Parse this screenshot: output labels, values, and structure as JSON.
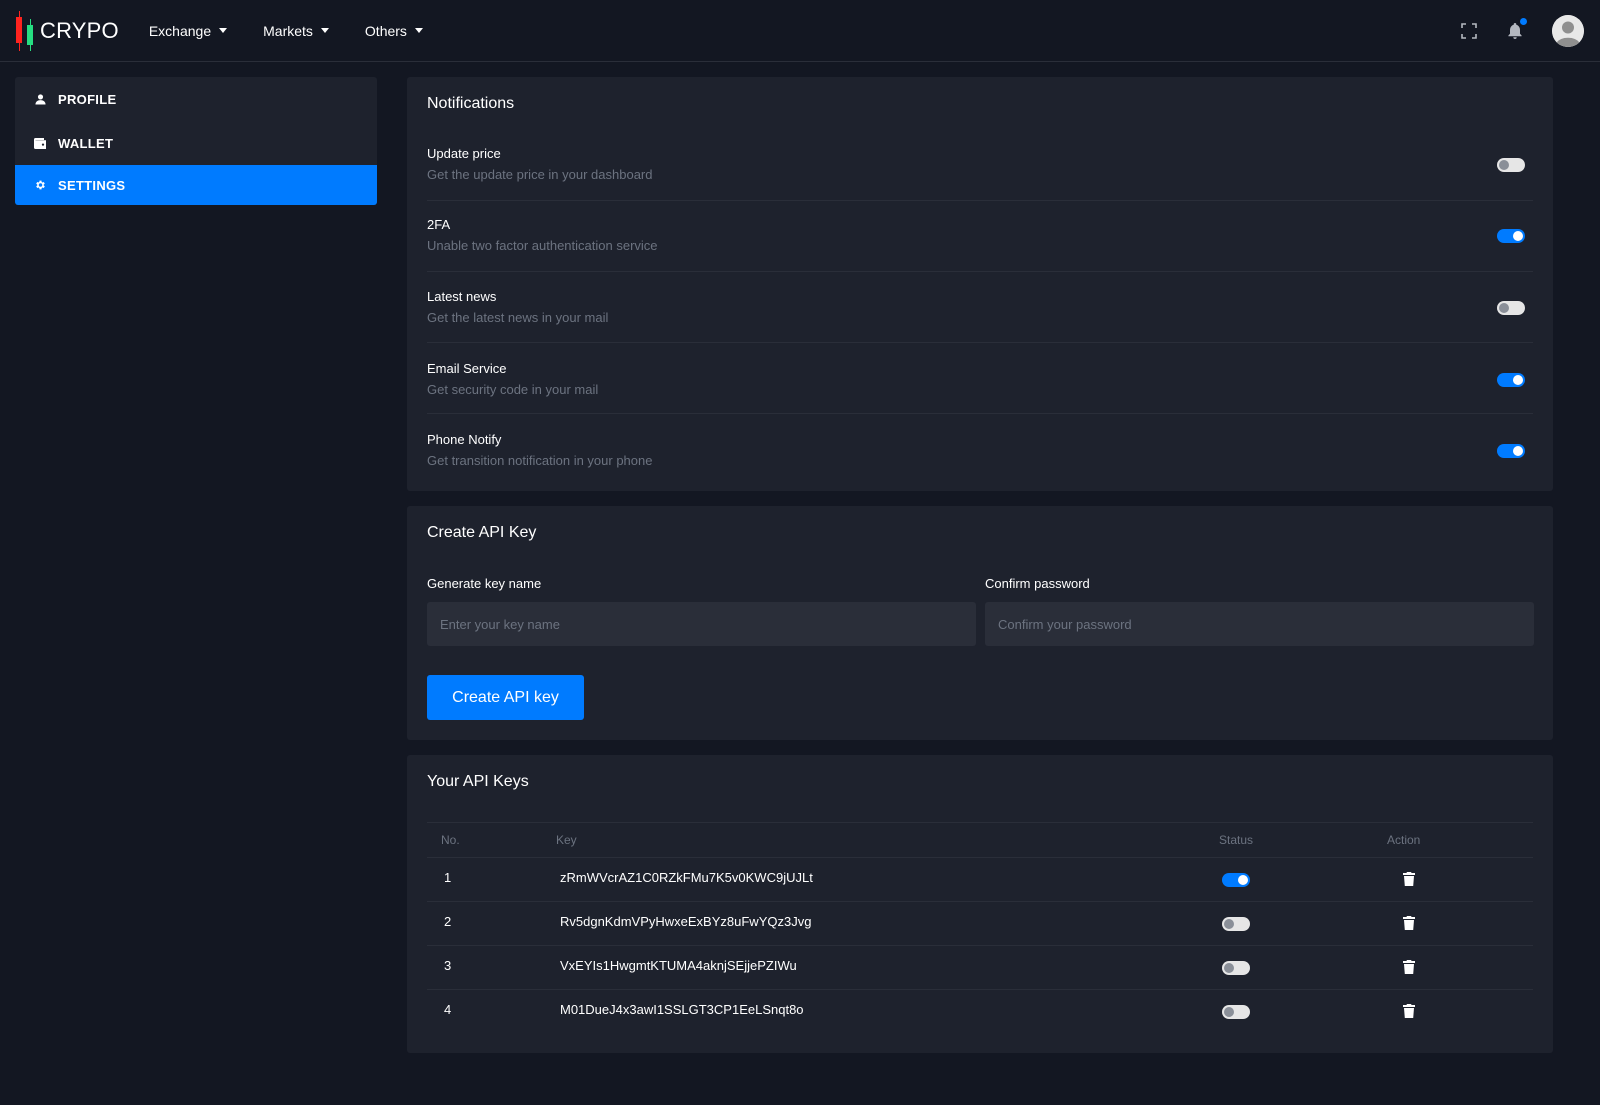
{
  "header": {
    "logo_text": "CRYPO",
    "nav": [
      {
        "label": "Exchange"
      },
      {
        "label": "Markets"
      },
      {
        "label": "Others"
      }
    ],
    "icons": [
      "fullscreen-icon",
      "bell-icon",
      "user-avatar"
    ]
  },
  "sidebar": {
    "items": [
      {
        "label": "PROFILE",
        "icon": "user-icon",
        "active": false
      },
      {
        "label": "WALLET",
        "icon": "wallet-icon",
        "active": false
      },
      {
        "label": "SETTINGS",
        "icon": "gear-icon",
        "active": true
      }
    ]
  },
  "notifications": {
    "title": "Notifications",
    "items": [
      {
        "label": "Update price",
        "description": "Get the update price in your dashboard",
        "enabled": false
      },
      {
        "label": "2FA",
        "description": "Unable two factor authentication service",
        "enabled": true
      },
      {
        "label": "Latest news",
        "description": "Get the latest news in your mail",
        "enabled": false
      },
      {
        "label": "Email Service",
        "description": "Get security code in your mail",
        "enabled": true
      },
      {
        "label": "Phone Notify",
        "description": "Get transition notification in your phone",
        "enabled": true
      }
    ]
  },
  "create_api": {
    "title": "Create API Key",
    "key_name_label": "Generate key name",
    "key_name_placeholder": "Enter your key name",
    "password_label": "Confirm password",
    "password_placeholder": "Confirm your password",
    "button_label": "Create API key"
  },
  "api_keys": {
    "title": "Your API Keys",
    "columns": [
      "No.",
      "Key",
      "Status",
      "Action"
    ],
    "rows": [
      {
        "no": "1",
        "key": "zRmWVcrAZ1C0RZkFMu7K5v0KWC9jUJLt",
        "enabled": true
      },
      {
        "no": "2",
        "key": "Rv5dgnKdmVPyHwxeExBYz8uFwYQz3Jvg",
        "enabled": false
      },
      {
        "no": "3",
        "key": "VxEYIs1HwgmtKTUMA4aknjSEjjePZIWu",
        "enabled": false
      },
      {
        "no": "4",
        "key": "M01DueJ4x3awI1SSLGT3CP1EeLSnqt8o",
        "enabled": false
      }
    ]
  },
  "colors": {
    "background": "#131722",
    "card": "#1e222d",
    "accent": "#007bff",
    "muted_text": "#6c7380"
  }
}
